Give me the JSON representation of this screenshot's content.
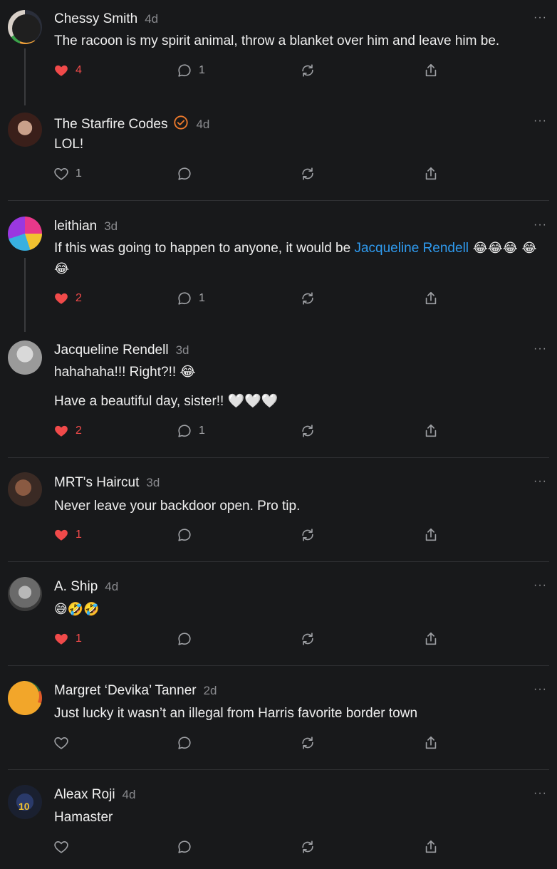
{
  "comments": [
    {
      "author": "Chessy Smith",
      "time": "4d",
      "text": "The racoon is my spirit animal, throw a blanket over him and leave him be.",
      "likes": "4",
      "replies": "1",
      "liked": true
    },
    {
      "author": "The Starfire Codes",
      "time": "4d",
      "text": "LOL!",
      "likes": "1",
      "replies": "",
      "liked": false
    },
    {
      "author": "leithian",
      "time": "3d",
      "text_before": "If this was going to happen to anyone, it would be ",
      "mention": "Jacqueline Rendell",
      "text_after": " 😂😂😂 😂😂",
      "likes": "2",
      "replies": "1",
      "liked": true
    },
    {
      "author": "Jacqueline Rendell",
      "time": "3d",
      "text": "hahahaha!!! Right?!! 😂",
      "text2": "Have a beautiful day, sister!! 🤍🤍🤍",
      "likes": "2",
      "replies": "1",
      "liked": true
    },
    {
      "author": "MRT's Haircut",
      "time": "3d",
      "text": "Never leave your backdoor open. Pro tip.",
      "likes": "1",
      "replies": "",
      "liked": true
    },
    {
      "author": "A. Ship",
      "time": "4d",
      "text": "😅🤣🤣",
      "likes": "1",
      "replies": "",
      "liked": true
    },
    {
      "author": "Margret ‘Devika’ Tanner",
      "time": "2d",
      "text": "Just lucky it wasn’t an illegal from Harris favorite border town",
      "likes": "",
      "replies": "",
      "liked": false
    },
    {
      "author": "Aleax Roji",
      "time": "4d",
      "text": "Hamaster",
      "likes": "",
      "replies": "",
      "liked": false
    }
  ],
  "more_label": "···",
  "icons": {
    "heart": "heart-icon",
    "reply": "comment-bubble-icon",
    "restack": "restack-icon",
    "share": "share-icon",
    "verified": "verified-badge-icon",
    "more": "more-options-icon"
  },
  "colors": {
    "liked": "#f04a4a",
    "mention": "#2f9bf0",
    "background": "#18191b"
  }
}
